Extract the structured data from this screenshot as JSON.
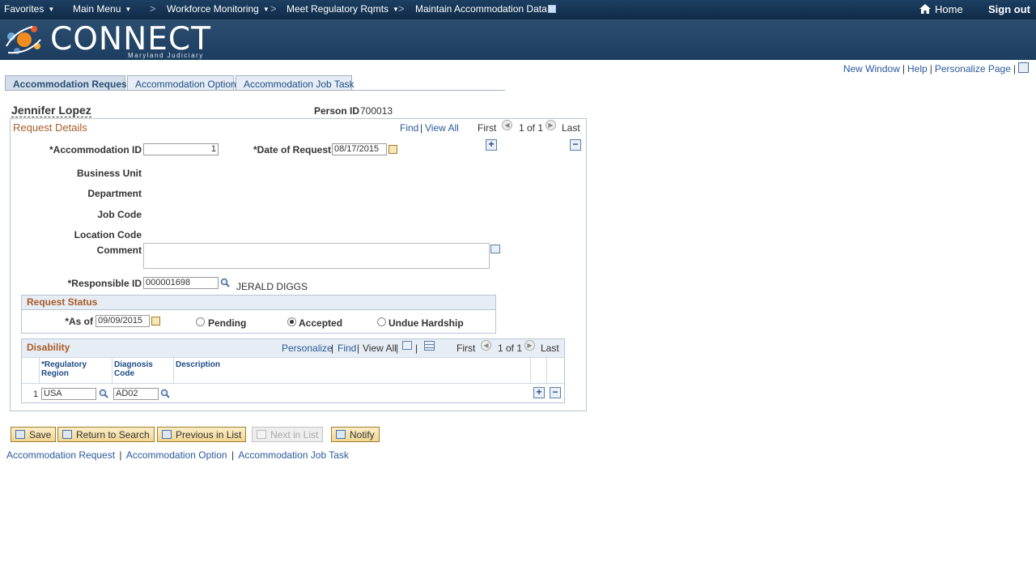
{
  "topnav": {
    "favorites": "Favorites",
    "main_menu": "Main Menu",
    "crumb1": "Workforce Monitoring",
    "crumb2": "Meet Regulatory Rqmts",
    "crumb3": "Maintain Accommodation Data",
    "home": "Home",
    "signout": "Sign out"
  },
  "banner": {
    "logo": "CONNECT",
    "sub": "Maryland Judiciary"
  },
  "pagelinks": {
    "new_window": "New Window",
    "help": "Help",
    "personalize": "Personalize Page"
  },
  "tabs": [
    "Accommodation Request",
    "Accommodation Option",
    "Accommodation Job Task"
  ],
  "person": {
    "name": "Jennifer Lopez",
    "id_label": "Person ID",
    "id_value": "700013"
  },
  "request_details": {
    "title": "Request Details",
    "find": "Find",
    "view_all": "View All",
    "first": "First",
    "count": "1 of 1",
    "last": "Last",
    "accommodation_id_label": "*Accommodation ID",
    "accommodation_id_value": "1",
    "date_label": "*Date of Request",
    "date_value": "08/17/2015",
    "business_unit": "Business Unit",
    "department": "Department",
    "job_code": "Job Code",
    "location_code": "Location Code",
    "comment": "Comment",
    "responsible_label": "*Responsible ID",
    "responsible_value": "000001698",
    "responsible_name": "JERALD DIGGS"
  },
  "request_status": {
    "title": "Request Status",
    "as_of_label": "*As of",
    "as_of_value": "09/09/2015",
    "options": [
      "Pending",
      "Accepted",
      "Undue Hardship"
    ],
    "selected": "Accepted"
  },
  "disability": {
    "title": "Disability",
    "personalize": "Personalize",
    "find": "Find",
    "view_all": "View All",
    "first": "First",
    "count": "1 of 1",
    "last": "Last",
    "col_region": "*Regulatory Region",
    "col_diag": "Diagnosis Code",
    "col_desc": "Description",
    "rows": [
      {
        "num": "1",
        "region": "USA",
        "diag": "AD02",
        "desc": ""
      }
    ]
  },
  "buttons": {
    "save": "Save",
    "return": "Return to Search",
    "previous": "Previous in List",
    "next": "Next in List",
    "notify": "Notify"
  },
  "bottomlinks": [
    "Accommodation Request",
    "Accommodation Option",
    "Accommodation Job Task"
  ],
  "colors": {
    "nav": "#1c3f63",
    "accent": "#a85b28",
    "link": "#2a5a9b"
  }
}
